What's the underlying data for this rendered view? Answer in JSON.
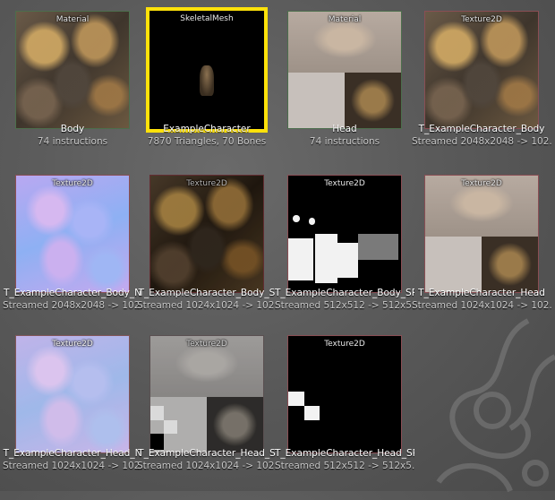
{
  "assets": [
    {
      "type": "Material",
      "name": "Body",
      "info": "74 instructions",
      "kind": "material-body",
      "selected": false
    },
    {
      "type": "SkeletalMesh",
      "name": "ExampleCharacter",
      "info": "7870 Triangles, 70 Bones",
      "kind": "mesh",
      "selected": true
    },
    {
      "type": "Material",
      "name": "Head",
      "info": "74 instructions",
      "kind": "material-head",
      "selected": false
    },
    {
      "type": "Texture2D",
      "name": "T_ExampleCharacter_Body",
      "info": "Streamed 2048x2048 -> 102...",
      "kind": "diffuse",
      "selected": false
    },
    {
      "type": "Texture2D",
      "name": "T_ExampleCharacter_Body_N",
      "info": "Streamed 2048x2048 -> 102...",
      "kind": "normal",
      "selected": false
    },
    {
      "type": "Texture2D",
      "name": "T_ExampleCharacter_Body_S",
      "info": "Streamed 1024x1024 -> 102...",
      "kind": "diffuse-dark",
      "selected": false
    },
    {
      "type": "Texture2D",
      "name": "T_ExampleCharacter_Body_SP",
      "info": "Streamed 512x512 -> 512x5...",
      "kind": "spec-body",
      "selected": false
    },
    {
      "type": "Texture2D",
      "name": "T_ExampleCharacter_Head",
      "info": "Streamed 1024x1024 -> 102...",
      "kind": "head",
      "selected": false
    },
    {
      "type": "Texture2D",
      "name": "T_ExampleCharacter_Head_N",
      "info": "Streamed 1024x1024 -> 102...",
      "kind": "normal-pale",
      "selected": false
    },
    {
      "type": "Texture2D",
      "name": "T_ExampleCharacter_Head_S",
      "info": "Streamed 1024x1024 -> 102...",
      "kind": "head-spec",
      "selected": false
    },
    {
      "type": "Texture2D",
      "name": "T_ExampleCharacter_Head_SP",
      "info": "Streamed 512x512 -> 512x5...",
      "kind": "spec-head",
      "selected": false
    }
  ],
  "colors": {
    "selection": "#ffe20a",
    "material_border": "#4c6e4c",
    "texture_border": "#8a4e54",
    "background": "#5a5a5a"
  }
}
